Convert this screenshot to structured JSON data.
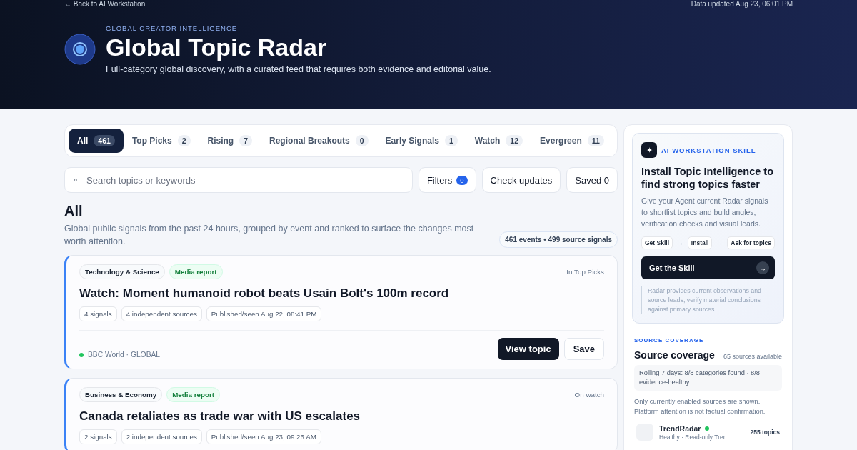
{
  "header": {
    "back_link": "← Back to AI Workstation",
    "updated": "Data updated Aug 23, 06:01 PM",
    "eyebrow": "GLOBAL CREATOR INTELLIGENCE",
    "title": "Global Topic Radar",
    "subtitle": "Full-category global discovery, with a curated feed that requires both evidence and editorial value."
  },
  "tabs": [
    {
      "label": "All",
      "count": "461",
      "selected": true
    },
    {
      "label": "Top Picks",
      "count": "2",
      "selected": false
    },
    {
      "label": "Rising",
      "count": "7",
      "selected": false
    },
    {
      "label": "Regional Breakouts",
      "count": "0",
      "selected": false
    },
    {
      "label": "Early Signals",
      "count": "1",
      "selected": false
    },
    {
      "label": "Watch",
      "count": "12",
      "selected": false
    },
    {
      "label": "Evergreen",
      "count": "11",
      "selected": false
    }
  ],
  "search": {
    "icon": "⌕",
    "placeholder": "Search topics or keywords"
  },
  "toolbar": {
    "filters": "Filters",
    "filters_count": "0",
    "check": "Check updates",
    "saved": "Saved 0"
  },
  "section": {
    "title": "All",
    "description": "Global public signals from the past 24 hours, grouped by event and ranked to surface the changes most worth attention.",
    "summary": "461 events • 499 source signals"
  },
  "topics": [
    {
      "category": "Technology & Science",
      "badge": "Media report",
      "status": "In Top Picks",
      "title": "Watch: Moment humanoid robot beats Usain Bolt's 100m record",
      "meta": [
        "4 signals",
        "4 independent sources",
        "Published/seen Aug 22, 08:41 PM"
      ],
      "source": "BBC World · GLOBAL",
      "color": "#22c55e",
      "actions": [
        "View topic",
        "Save"
      ]
    },
    {
      "category": "Business & Economy",
      "badge": "Media report",
      "status": "On watch",
      "title": "Canada retaliates as trade war with US escalates",
      "meta": [
        "2 signals",
        "2 independent sources",
        "Published/seen Aug 23, 09:26 AM"
      ]
    }
  ],
  "skill": {
    "icon": "✦",
    "eyebrow": "AI WORKSTATION SKILL",
    "title": "Install Topic Intelligence to find strong topics faster",
    "text": "Give your Agent current Radar signals to shortlist topics and build angles, verification checks and visual leads.",
    "steps": [
      "Get Skill",
      "Install",
      "Ask for topics"
    ],
    "step_arrow": "→",
    "cta": "Get the Skill",
    "cta_arrow": "→",
    "note": "Radar provides current observations and source leads; verify material conclusions against primary sources."
  },
  "coverage": {
    "eyebrow": "SOURCE COVERAGE",
    "title": "Source coverage",
    "count": "65 sources available",
    "rolling": "Rolling 7 days: 8/8 categories found · 8/8 evidence-healthy",
    "note": "Only currently enabled sources are shown. Platform attention is not factual confirmation.",
    "sources": [
      {
        "name": "TrendRadar",
        "color": "#22c55e",
        "detail": "Healthy · Read-only Tren...",
        "topics": "255 topics"
      }
    ]
  }
}
